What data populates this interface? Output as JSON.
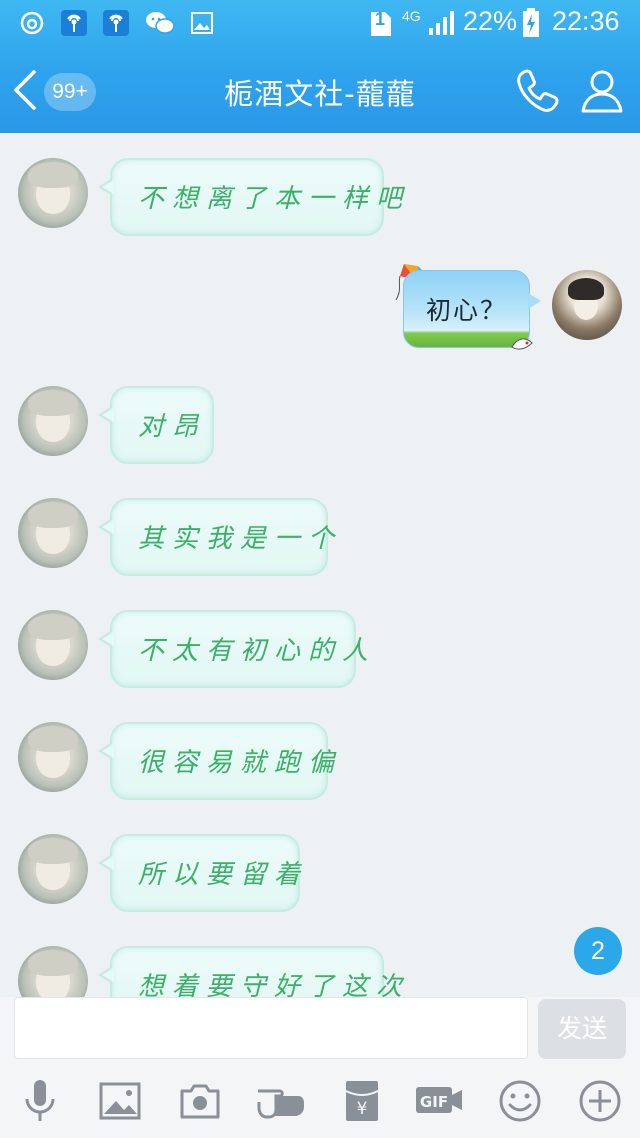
{
  "status_bar": {
    "sim": "1",
    "network": "4G",
    "battery": "22%",
    "time": "22:36"
  },
  "header": {
    "unread_count": "99+",
    "title": "栀酒文社-蘢蘢",
    "phone_icon": "phone-icon",
    "profile_icon": "person-icon"
  },
  "messages": [
    {
      "from": "other",
      "text": "不想离了本一样吧"
    },
    {
      "from": "me",
      "text": "初心？"
    },
    {
      "from": "other",
      "text": "对昂"
    },
    {
      "from": "other",
      "text": "其实我是一个"
    },
    {
      "from": "other",
      "text": "不太有初心的人"
    },
    {
      "from": "other",
      "text": "很容易就跑偏"
    },
    {
      "from": "other",
      "text": "所以要留着"
    },
    {
      "from": "other",
      "text": "想着要守好了这次"
    }
  ],
  "new_message_badge": "2",
  "input": {
    "placeholder": "",
    "send_label": "发送"
  },
  "toolbar": {
    "items": [
      "microphone-icon",
      "image-icon",
      "camera-icon",
      "poke-hand-icon",
      "red-packet-icon",
      "gif-icon",
      "emoji-icon",
      "plus-icon"
    ],
    "gif_label": "GIF"
  },
  "colors": {
    "header": "#2ea3ec",
    "received_text": "#3bb06a",
    "badge": "#2aa8e9"
  }
}
